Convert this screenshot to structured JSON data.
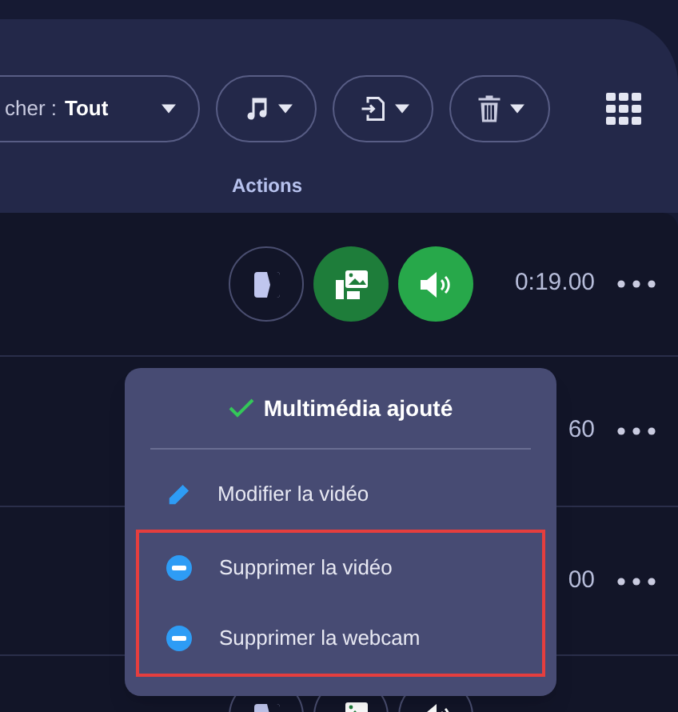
{
  "toolbar": {
    "filter": {
      "label": "cher :",
      "value": "Tout"
    },
    "section_label": "Actions"
  },
  "rows": [
    {
      "time": "0:19.00",
      "buttons": [
        {
          "kind": "split",
          "active": false
        },
        {
          "kind": "media",
          "active": true
        },
        {
          "kind": "sound",
          "active": true
        }
      ]
    },
    {
      "time": "60"
    },
    {
      "time": "00"
    },
    {
      "buttons": [
        {
          "kind": "split",
          "active": false
        },
        {
          "kind": "media",
          "active": false
        },
        {
          "kind": "sound",
          "active": false
        }
      ]
    }
  ],
  "popup": {
    "title": "Multimédia ajouté",
    "items": [
      {
        "kind": "edit",
        "label": "Modifier la vidéo",
        "highlighted": false
      },
      {
        "kind": "remove",
        "label": "Supprimer la vidéo",
        "highlighted": true
      },
      {
        "kind": "remove",
        "label": "Supprimer la webcam",
        "highlighted": true
      }
    ]
  }
}
